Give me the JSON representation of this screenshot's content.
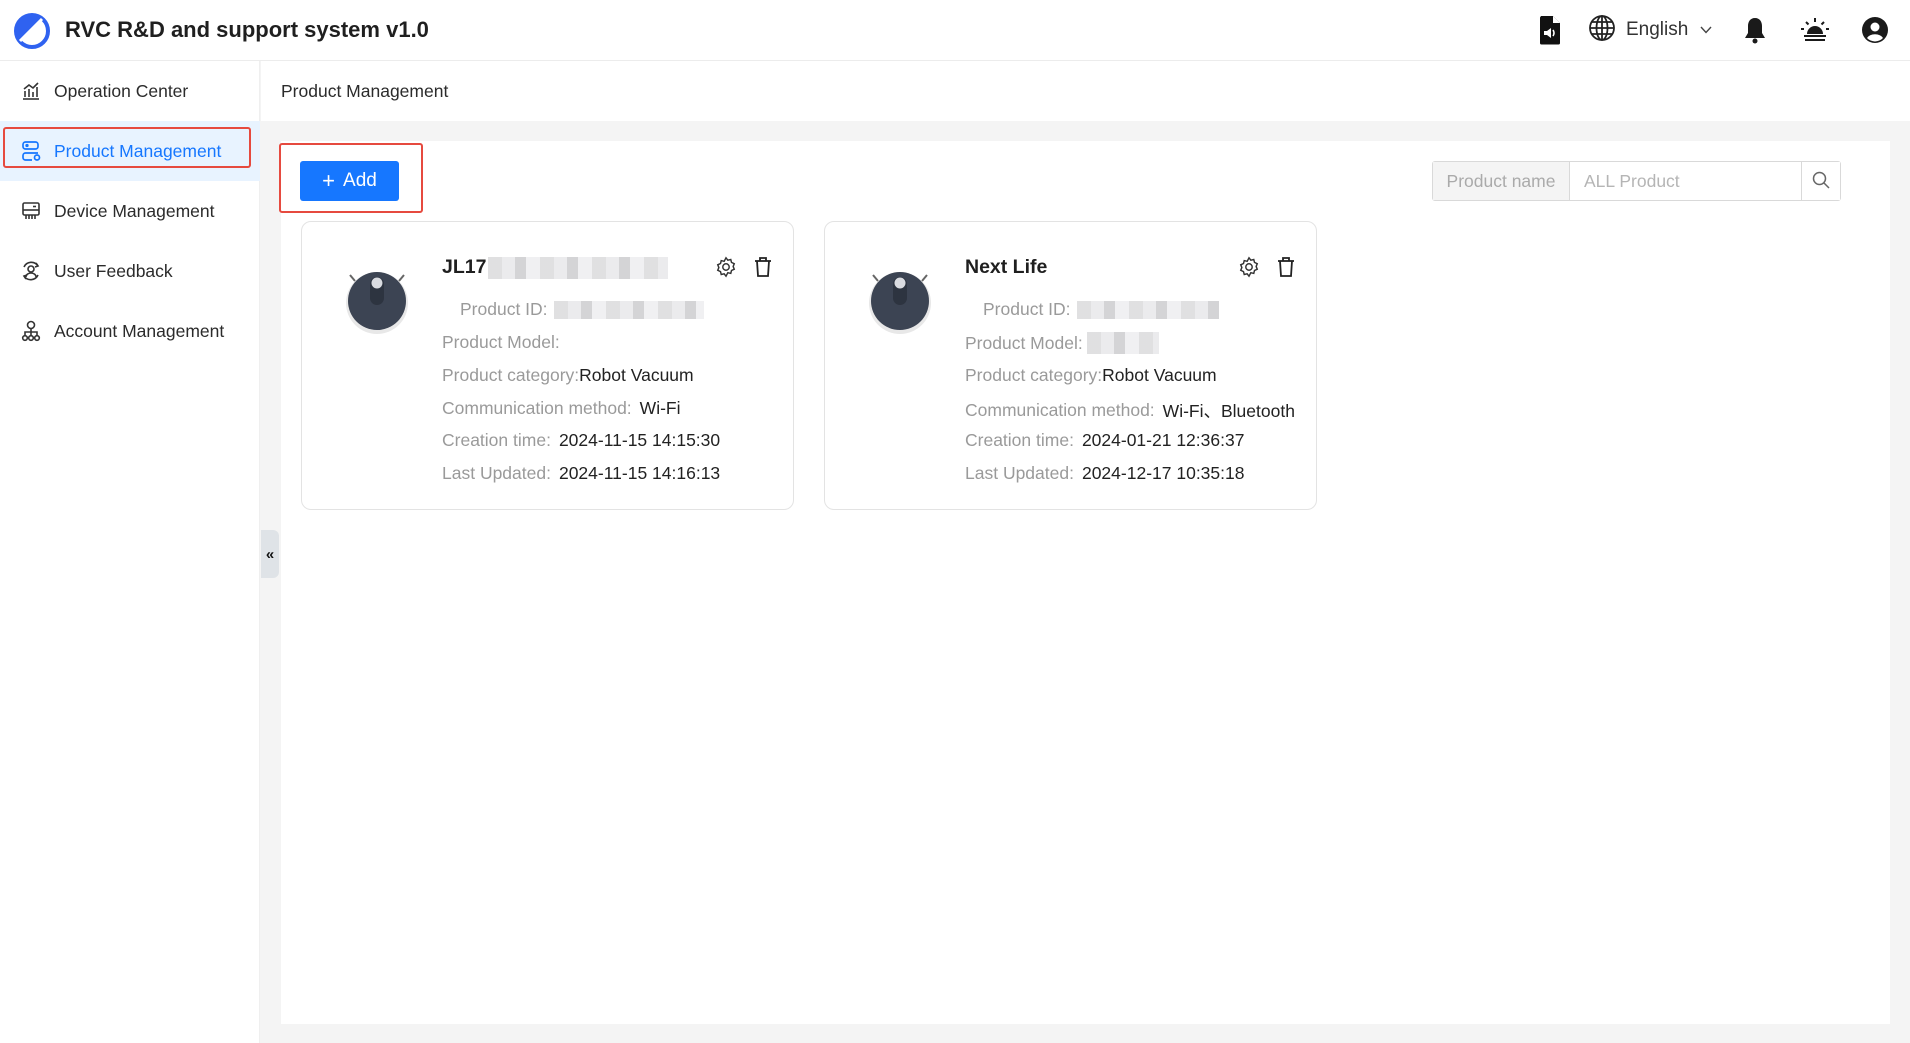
{
  "app": {
    "title": "RVC R&D and support system v1.0",
    "brand_color": "#2f62f0"
  },
  "header": {
    "language": "English",
    "icons": [
      "document-audio-icon",
      "globe-icon",
      "chevron-down-icon",
      "bell-icon",
      "alarm-light-icon",
      "user-avatar-icon"
    ]
  },
  "sidebar": {
    "items": [
      {
        "label": "Operation Center",
        "icon": "chart-icon",
        "active": false
      },
      {
        "label": "Product Management",
        "icon": "product-icon",
        "active": true
      },
      {
        "label": "Device Management",
        "icon": "device-icon",
        "active": false
      },
      {
        "label": "User Feedback",
        "icon": "feedback-icon",
        "active": false
      },
      {
        "label": "Account Management",
        "icon": "account-tree-icon",
        "active": false
      }
    ],
    "collapse_label": "«"
  },
  "breadcrumb": "Product Management",
  "toolbar": {
    "add_label": "Add",
    "add_icon": "+",
    "search_addon": "Product name",
    "search_placeholder": "ALL Product",
    "search_value": ""
  },
  "accent_color": "#1677ff",
  "highlight_color": "#e64a3f",
  "labels": {
    "product_id": "Product ID:",
    "product_model": "Product Model:",
    "product_category": "Product category:",
    "communication_method": "Communication method:",
    "creation_time": "Creation time:",
    "last_updated": "Last Updated:"
  },
  "products": [
    {
      "name": "JL17",
      "name_redacted": true,
      "product_id": "",
      "product_model": "",
      "category": "Robot Vacuum",
      "communication": "Wi-Fi",
      "creation_time": "2024-11-15 14:15:30",
      "last_updated": "2024-11-15 14:16:13"
    },
    {
      "name": "Next Life",
      "name_redacted": false,
      "product_id": "",
      "product_model": "",
      "category": "Robot Vacuum",
      "communication": "Wi-Fi、Bluetooth",
      "creation_time": "2024-01-21 12:36:37",
      "last_updated": "2024-12-17 10:35:18"
    }
  ]
}
